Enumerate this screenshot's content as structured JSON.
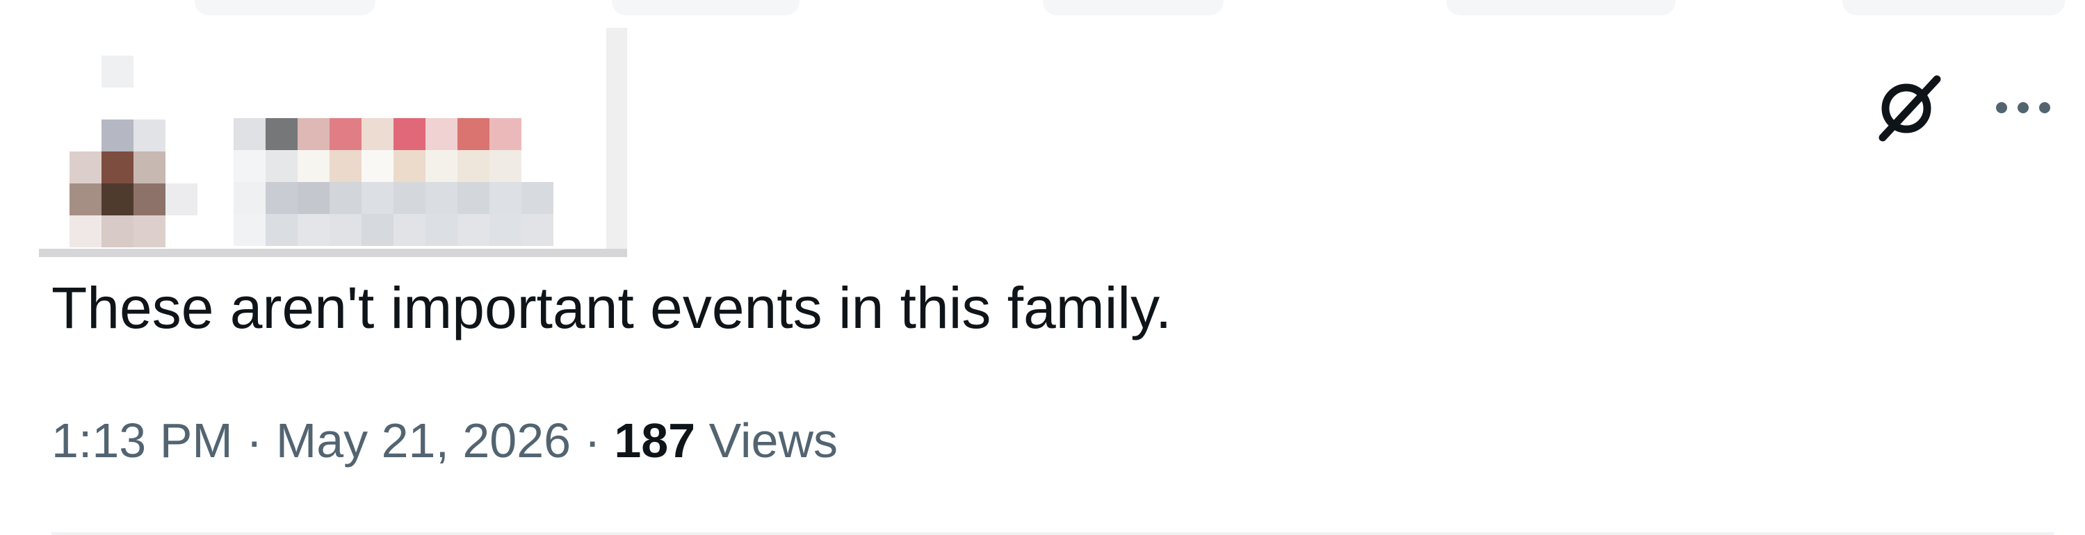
{
  "tweet": {
    "text": "These aren't important events in this family.",
    "time": "1:13 PM",
    "separator": "·",
    "date": "May 21, 2026",
    "views_count": "187",
    "views_label": "Views"
  },
  "actions": {
    "grok_icon": "grok-icon",
    "more_icon": "more-icon"
  },
  "author": {
    "redacted": true
  },
  "colors": {
    "text": "#0f1419",
    "secondary": "#536471",
    "divider": "#eff3f4"
  }
}
